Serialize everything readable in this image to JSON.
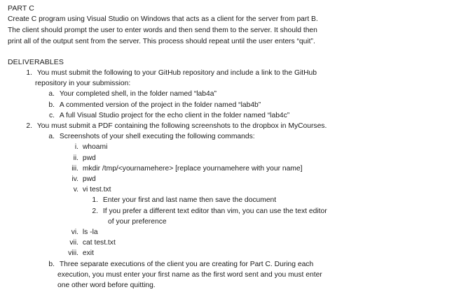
{
  "part_c": {
    "title": "PART C",
    "paragraph": [
      "Create C program using Visual Studio on Windows that acts as a client for the server from part B.",
      "The client should prompt the user to enter words and then send them to the server. It should then",
      "print all of the output sent from the server. This process should repeat until the user enters “quit”."
    ]
  },
  "deliverables": {
    "title": "DELIVERABLES",
    "item1": {
      "marker": "1.",
      "text": "You must submit the following to your GitHub repository and include a link to the GitHub",
      "text_cont": "repository in your submission:",
      "sub": [
        {
          "marker": "a.",
          "text": "Your completed shell, in the folder named “lab4a”"
        },
        {
          "marker": "b.",
          "text": "A commented version of the project in the folder named “lab4b”"
        },
        {
          "marker": "c.",
          "text": "A full Visual Studio project for the echo client in the folder named “lab4c”"
        }
      ]
    },
    "item2": {
      "marker": "2.",
      "text": "You must submit a PDF containing the following screenshots to the dropbox in MyCourses.",
      "sub_a": {
        "marker": "a.",
        "text": "Screenshots of your shell executing the following commands:",
        "commands": [
          {
            "marker": "i.",
            "text": "whoami"
          },
          {
            "marker": "ii.",
            "text": "pwd"
          },
          {
            "marker": "iii.",
            "text": "mkdir /tmp/<yournamehere> [replace yournamehere with your name]"
          },
          {
            "marker": "iv.",
            "text": "pwd"
          },
          {
            "marker": "v.",
            "text": "vi test.txt"
          }
        ],
        "vi_sub": [
          {
            "marker": "1.",
            "text": "Enter your first and last name then save the document"
          },
          {
            "marker": "2.",
            "text": "If you prefer a different text editor than vim, you can use the text editor",
            "text_cont": "of your preference"
          }
        ],
        "commands_after": [
          {
            "marker": "vi.",
            "text": "ls -la"
          },
          {
            "marker": "vii.",
            "text": "cat test.txt"
          },
          {
            "marker": "viii.",
            "text": "exit"
          }
        ]
      },
      "sub_b": {
        "marker": "b.",
        "lines": [
          "Three separate executions of the client you are creating for Part C. During each",
          "execution, you must enter your first name as the first word sent and you must enter",
          "one other word before quitting."
        ]
      }
    }
  }
}
